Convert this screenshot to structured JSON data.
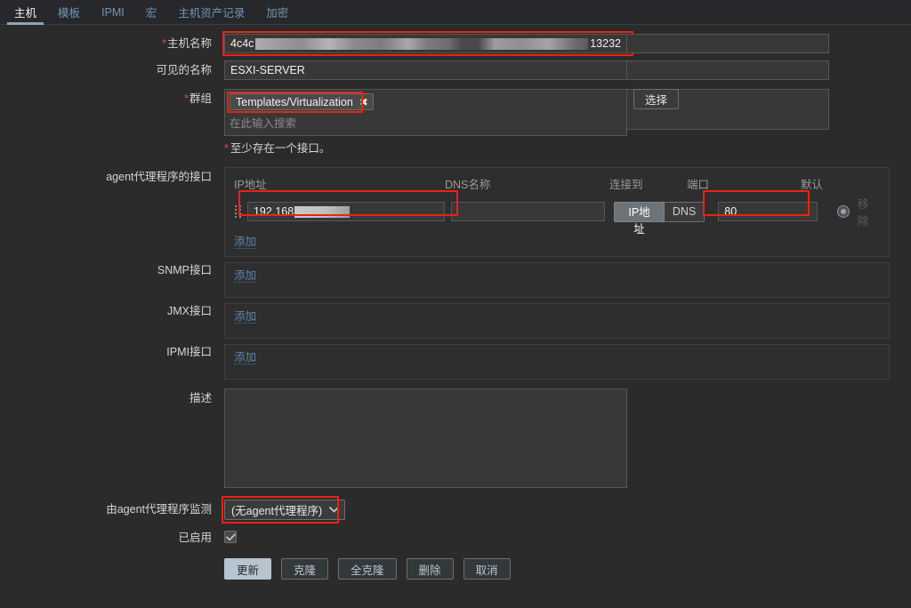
{
  "tabs": [
    {
      "label": "主机",
      "active": true
    },
    {
      "label": "模板",
      "active": false
    },
    {
      "label": "IPMI",
      "active": false
    },
    {
      "label": "宏",
      "active": false
    },
    {
      "label": "主机资产记录",
      "active": false
    },
    {
      "label": "加密",
      "active": false
    }
  ],
  "form": {
    "hostname": {
      "label": "主机名称",
      "required": true,
      "value_prefix": "4c4c",
      "value_suffix": "13232",
      "redacted": true
    },
    "visible_name": {
      "label": "可见的名称",
      "required": false,
      "value": "ESXI-SERVER"
    },
    "groups": {
      "label": "群组",
      "required": true,
      "chips": [
        "Templates/Virtualization"
      ],
      "chip_remove_icon": "✖",
      "placeholder": "在此输入搜索",
      "select_button": "选择"
    },
    "interface_note": "至少存在一个接口。",
    "agent_interfaces": {
      "label": "agent代理程序的接口",
      "columns": [
        "IP地址",
        "DNS名称",
        "连接到",
        "端口",
        "默认"
      ],
      "rows": [
        {
          "ip": "192.168",
          "ip_redacted": true,
          "dns": "",
          "connect_to": [
            "IP地址",
            "DNS"
          ],
          "connect_to_selected": "IP地址",
          "port": "80",
          "default_selected": true,
          "remove_label": "移除"
        }
      ],
      "add_label": "添加"
    },
    "snmp_interfaces": {
      "label": "SNMP接口",
      "add_label": "添加"
    },
    "jmx_interfaces": {
      "label": "JMX接口",
      "add_label": "添加"
    },
    "ipmi_interfaces": {
      "label": "IPMI接口",
      "add_label": "添加"
    },
    "description": {
      "label": "描述",
      "value": "",
      "placeholder": ""
    },
    "monitored_by": {
      "label": "由agent代理程序监测",
      "value": "(无agent代理程序)",
      "chevron": "chevron-down"
    },
    "enabled": {
      "label": "已启用",
      "checked": true
    }
  },
  "footer": {
    "buttons": [
      {
        "label": "更新",
        "primary": true
      },
      {
        "label": "克隆",
        "primary": false
      },
      {
        "label": "全克隆",
        "primary": false
      },
      {
        "label": "删除",
        "primary": false
      },
      {
        "label": "取消",
        "primary": false
      }
    ]
  },
  "colors": {
    "background": "#2b2b2b",
    "tabbar": "#26282b",
    "accent_link": "#5c85ad",
    "highlight": "#ee2211",
    "required": "#d64e4e",
    "active_tab_underline": "#8ea5b5"
  }
}
